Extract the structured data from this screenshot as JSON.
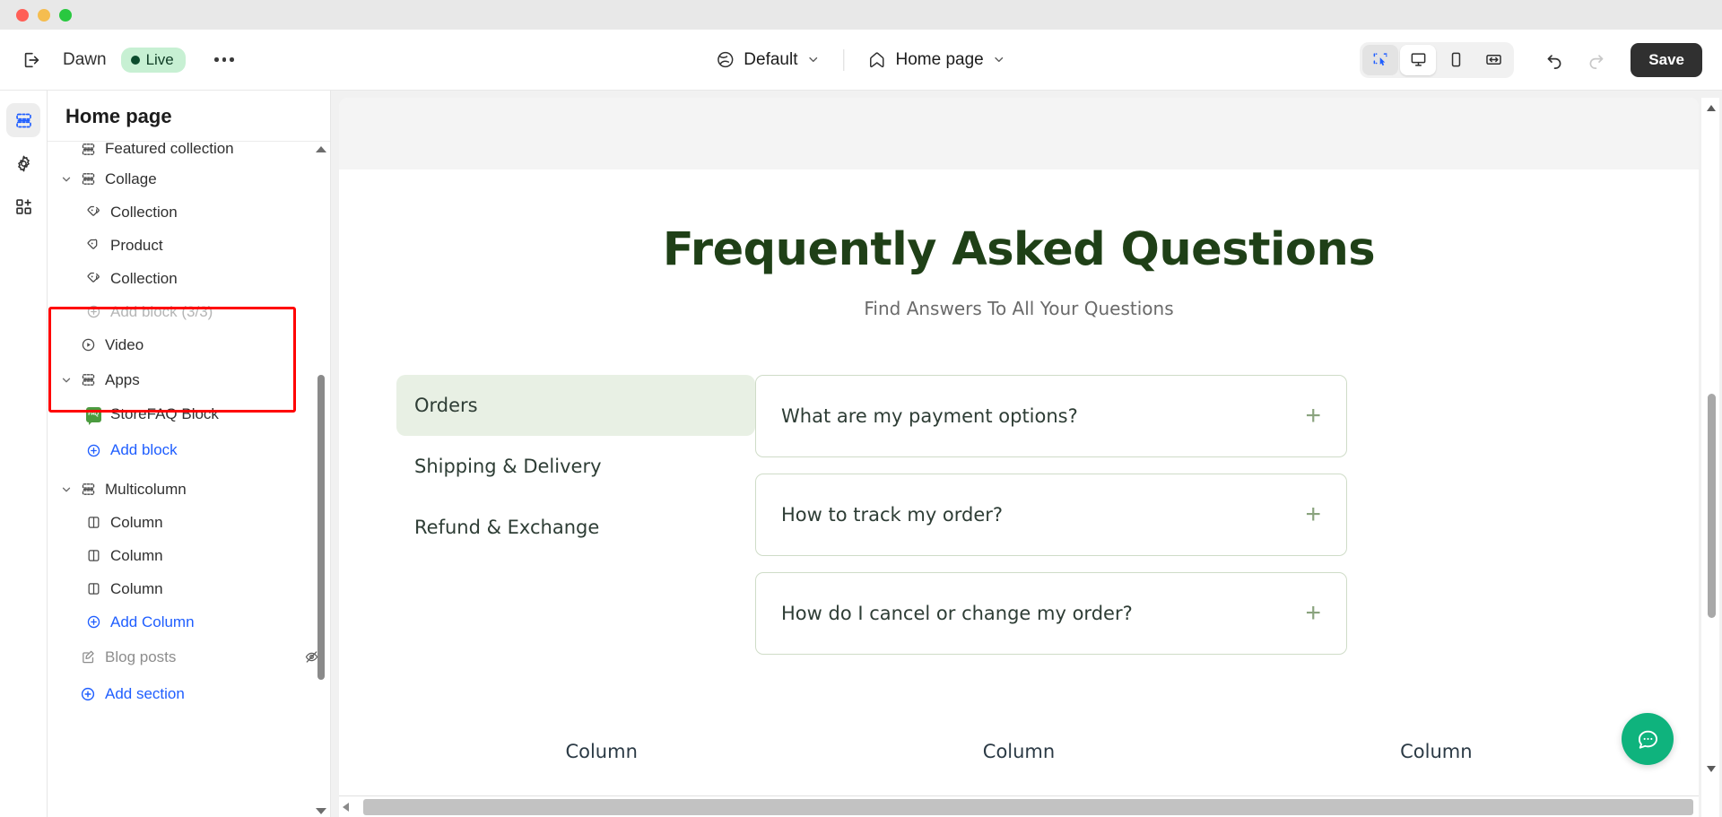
{
  "window": {
    "controls": [
      "close",
      "minimize",
      "maximize"
    ]
  },
  "topbar": {
    "exit_icon": "exit-icon",
    "store_name": "Dawn",
    "status_badge": "Live",
    "more_icon": "ellipsis-icon",
    "theme_selector": {
      "icon": "globe-icon",
      "label": "Default",
      "chevron": "chevron-down-icon"
    },
    "page_selector": {
      "icon": "home-icon",
      "label": "Home page",
      "chevron": "chevron-down-icon"
    },
    "view_modes": [
      {
        "name": "select-tool",
        "icon": "cursor-select-icon",
        "active": true
      },
      {
        "name": "desktop-view",
        "icon": "desktop-icon",
        "active": true
      },
      {
        "name": "mobile-view",
        "icon": "mobile-icon",
        "active": false
      },
      {
        "name": "fullwidth-view",
        "icon": "fullwidth-icon",
        "active": false
      }
    ],
    "undo": {
      "icon": "undo-icon",
      "enabled": true
    },
    "redo": {
      "icon": "redo-icon",
      "enabled": false
    },
    "save_label": "Save"
  },
  "rail": {
    "items": [
      {
        "name": "sections-rail",
        "icon": "sections-icon",
        "active": true
      },
      {
        "name": "settings-rail",
        "icon": "gear-icon",
        "active": false
      },
      {
        "name": "apps-rail",
        "icon": "apps-grid-plus-icon",
        "active": false
      }
    ]
  },
  "sidebar": {
    "title": "Home page",
    "rows": [
      {
        "label": "Featured collection",
        "level": 0,
        "icon": "section-icon",
        "chevron": "",
        "kind": "section",
        "clipped": true
      },
      {
        "label": "Collage",
        "level": 0,
        "icon": "section-icon",
        "chevron": "chevron-down-icon",
        "kind": "section"
      },
      {
        "label": "Collection",
        "level": 1,
        "icon": "collection-tag-icon",
        "kind": "block"
      },
      {
        "label": "Product",
        "level": 1,
        "icon": "product-tag-icon",
        "kind": "block"
      },
      {
        "label": "Collection",
        "level": 1,
        "icon": "collection-tag-icon",
        "kind": "block"
      },
      {
        "label": "Add block (3/3)",
        "level": 1,
        "icon": "plus-circle-icon",
        "kind": "add-disabled"
      },
      {
        "label": "Video",
        "level": 0,
        "icon": "video-play-icon",
        "chevron": "",
        "kind": "section"
      },
      {
        "label": "Apps",
        "level": 0,
        "icon": "section-icon",
        "chevron": "chevron-down-icon",
        "kind": "section",
        "highlighted": true
      },
      {
        "label": "StoreFAQ Block",
        "level": 1,
        "icon": "storefaq-app-icon",
        "kind": "block",
        "highlighted": true
      },
      {
        "label": "Add block",
        "level": 1,
        "icon": "plus-circle-icon",
        "kind": "add-link",
        "highlighted": true
      },
      {
        "label": "Multicolumn",
        "level": 0,
        "icon": "section-icon",
        "chevron": "chevron-down-icon",
        "kind": "section"
      },
      {
        "label": "Column",
        "level": 1,
        "icon": "column-icon",
        "kind": "block"
      },
      {
        "label": "Column",
        "level": 1,
        "icon": "column-icon",
        "kind": "block"
      },
      {
        "label": "Column",
        "level": 1,
        "icon": "column-icon",
        "kind": "block"
      },
      {
        "label": "Add Column",
        "level": 1,
        "icon": "plus-circle-icon",
        "kind": "add-link"
      },
      {
        "label": "Blog posts",
        "level": 0,
        "icon": "blog-edit-icon",
        "chevron": "",
        "kind": "section",
        "eye": "hidden-eye-icon"
      },
      {
        "label": "Add section",
        "level": 0,
        "icon": "plus-circle-icon",
        "kind": "add-link"
      }
    ],
    "app_icon_text": "FAQ"
  },
  "preview": {
    "faq": {
      "title": "Frequently Asked Questions",
      "subtitle": "Find Answers To All Your Questions",
      "categories": [
        {
          "label": "Orders",
          "active": true
        },
        {
          "label": "Shipping & Delivery",
          "active": false
        },
        {
          "label": "Refund & Exchange",
          "active": false
        }
      ],
      "questions": [
        {
          "text": "What are my payment options?",
          "toggle": "plus-icon"
        },
        {
          "text": "How to track my order?",
          "toggle": "plus-icon"
        },
        {
          "text": "How do I cancel or change my order?",
          "toggle": "plus-icon"
        }
      ]
    },
    "multicolumn_labels": [
      "Column",
      "Column",
      "Column"
    ],
    "chat_widget": "chat-bubble-icon"
  },
  "colors": {
    "brand_green": "#1f4017",
    "category_active_bg": "#e8f0e4",
    "accordion_border": "#cfdcc8",
    "link_blue": "#1f5eff",
    "live_badge_bg": "#c7f0d3",
    "chat_fab": "#0fb37d",
    "annotation_red": "#ff0000",
    "save_bg": "#303030"
  }
}
